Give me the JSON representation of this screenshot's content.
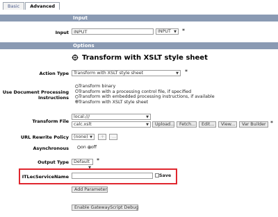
{
  "tabs": [
    {
      "label": "Basic",
      "active": false
    },
    {
      "label": "Advanced",
      "active": true
    }
  ],
  "sections": {
    "input": "Input",
    "options": "Options"
  },
  "input_row": {
    "label": "Input",
    "value": "INPUT",
    "select": "INPUT",
    "required": "*"
  },
  "options": {
    "title": "Transform with XSLT style sheet",
    "action_type": {
      "label": "Action Type",
      "value": "Transform with XSLT style sheet",
      "required": "*"
    },
    "processing": {
      "label_line1": "Use Document Processing",
      "label_line2": "Instructions",
      "choices": [
        {
          "label": "Transform binary",
          "selected": false
        },
        {
          "label": "Transform with a processing control file, if specified",
          "selected": false
        },
        {
          "label": "Transform with embedded processing instructions, if available",
          "selected": false
        },
        {
          "label": "Transform with XSLT style sheet",
          "selected": true
        }
      ]
    },
    "transform_file": {
      "label": "Transform File",
      "location": "local:///",
      "file": "calc.xslt",
      "buttons": [
        "Upload...",
        "Fetch...",
        "Edit...",
        "View...",
        "Var Builder"
      ],
      "required": "*"
    },
    "url_rewrite": {
      "label": "URL Rewrite Policy",
      "value": "(none)",
      "plus": "+",
      "dots": "..."
    },
    "asynchronous": {
      "label": "Asynchronous",
      "on": "on",
      "off": "off",
      "selected": "off"
    },
    "output_type": {
      "label": "Output Type",
      "value": "Default",
      "required": "*"
    },
    "param": {
      "label": "ITLecServiceName",
      "value": "",
      "save": "Save"
    },
    "add_parameter": "Add Parameter",
    "gatewayscript_debug": "Enable GatewayScript Debug"
  },
  "colors": {
    "section_bar": "#8a9ab3",
    "highlight": "#e0262e"
  }
}
